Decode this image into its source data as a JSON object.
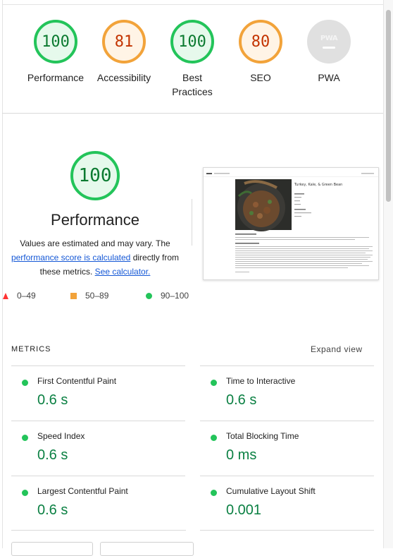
{
  "top_gauges": [
    {
      "score": "100",
      "label": "Performance",
      "status": "pass"
    },
    {
      "score": "81",
      "label": "Accessibility",
      "status": "average"
    },
    {
      "score": "100",
      "label": "Best Practices",
      "status": "pass"
    },
    {
      "score": "80",
      "label": "SEO",
      "status": "average"
    },
    {
      "score": "",
      "label": "PWA",
      "status": "na"
    }
  ],
  "pwa_badge": "PWA",
  "performance": {
    "score": "100",
    "title": "Performance",
    "desc_prefix": "Values are estimated and may vary. The ",
    "desc_link": "performance score is calculated",
    "desc_middle": " directly from these metrics. ",
    "desc_calc_link": "See calculator."
  },
  "thumbnail": {
    "recipe_title": "Turkey, Kale, & Green Bean"
  },
  "legend": [
    {
      "range": "0–49",
      "shape": "triangle",
      "color": "#ff3333"
    },
    {
      "range": "50–89",
      "shape": "square",
      "color": "#f2a33a"
    },
    {
      "range": "90–100",
      "shape": "circle",
      "color": "#23c45a"
    }
  ],
  "metrics": {
    "heading": "METRICS",
    "expand_label": "Expand view",
    "items": [
      {
        "name": "First Contentful Paint",
        "value": "0.6 s"
      },
      {
        "name": "Time to Interactive",
        "value": "0.6 s"
      },
      {
        "name": "Speed Index",
        "value": "0.6 s"
      },
      {
        "name": "Total Blocking Time",
        "value": "0 ms"
      },
      {
        "name": "Largest Contentful Paint",
        "value": "0.6 s"
      },
      {
        "name": "Cumulative Layout Shift",
        "value": "0.001"
      }
    ]
  },
  "colors": {
    "pass": "#0b8043",
    "average": "#c33300",
    "accent_link": "#1558d6"
  }
}
